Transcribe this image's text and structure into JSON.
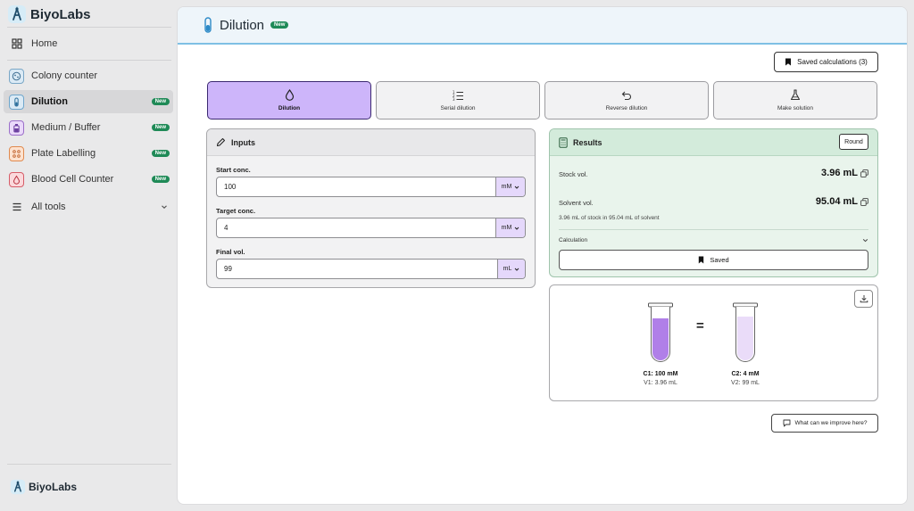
{
  "sidebar": {
    "brand": "BiyoLabs",
    "items": [
      {
        "label": "Home"
      },
      {
        "label": "Colony counter"
      },
      {
        "label": "Dilution",
        "badge": "New"
      },
      {
        "label": "Medium / Buffer",
        "badge": "New"
      },
      {
        "label": "Plate Labelling",
        "badge": "New"
      },
      {
        "label": "Blood Cell Counter",
        "badge": "New"
      },
      {
        "label": "All tools"
      }
    ],
    "footer_brand": "BiyoLabs"
  },
  "header": {
    "title": "Dilution",
    "badge": "New"
  },
  "toolbar": {
    "saved_calculations": "Saved calculations (3)"
  },
  "tabs": [
    {
      "label": "Dilution"
    },
    {
      "label": "Serial dilution"
    },
    {
      "label": "Reverse dilution"
    },
    {
      "label": "Make solution"
    }
  ],
  "inputs": {
    "title": "Inputs",
    "start_conc": {
      "label": "Start conc.",
      "value": "100",
      "unit": "mM"
    },
    "target_conc": {
      "label": "Target conc.",
      "value": "4",
      "unit": "mM"
    },
    "final_vol": {
      "label": "Final vol.",
      "value": "99",
      "unit": "mL"
    }
  },
  "results": {
    "title": "Results",
    "round_label": "Round",
    "stock_label": "Stock vol.",
    "stock_value": "3.96 mL",
    "solvent_label": "Solvent vol.",
    "solvent_value": "95.04 mL",
    "summary": "3.96 mL of stock in 95.04 mL of solvent",
    "calculation_label": "Calculation",
    "saved_label": "Saved"
  },
  "visual": {
    "equals": "=",
    "tube1_title": "C1: 100 mM",
    "tube1_sub": "V1: 3.96 mL",
    "tube2_title": "C2: 4 mM",
    "tube2_sub": "V2: 99 mL",
    "tube1_color": "#b07fe8",
    "tube2_color": "#eadcf9"
  },
  "feedback": {
    "label": "What can we improve here?"
  },
  "colors": {
    "accent": "#cdb5fa",
    "header_line": "#7fc0e4",
    "badge": "#1f8a57",
    "results_bg": "#e9f4ec"
  }
}
